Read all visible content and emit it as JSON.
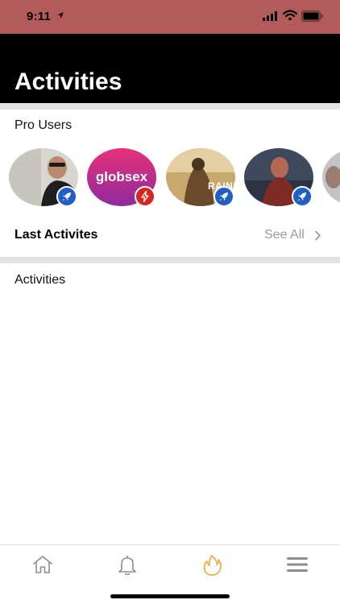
{
  "status_bar": {
    "time": "9:11"
  },
  "header": {
    "title": "Activities"
  },
  "pro_users": {
    "label": "Pro Users",
    "users": [
      {
        "badge_icon": "rocket-icon",
        "badge_color": "#1f5fc7"
      },
      {
        "avatar_text": "globsex",
        "badge_icon": "lightning-icon",
        "badge_color": "#d7261e"
      },
      {
        "avatar_text": "RAINB",
        "badge_icon": "rocket-icon",
        "badge_color": "#1f5fc7"
      },
      {
        "badge_icon": "rocket-icon",
        "badge_color": "#1f5fc7"
      },
      {
        "badge_icon": "rocket-icon",
        "badge_color": "#1f5fc7"
      }
    ]
  },
  "last_activities": {
    "title": "Last Activites",
    "see_all": "See All"
  },
  "activities": {
    "label": "Activities"
  },
  "tab_bar": {
    "tabs": [
      {
        "icon": "home-icon",
        "active": false
      },
      {
        "icon": "bell-icon",
        "active": false
      },
      {
        "icon": "flame-icon",
        "active": true
      },
      {
        "icon": "menu-icon",
        "active": false
      }
    ],
    "active_color": "#f2a93b",
    "inactive_color": "#8e8e8e"
  }
}
